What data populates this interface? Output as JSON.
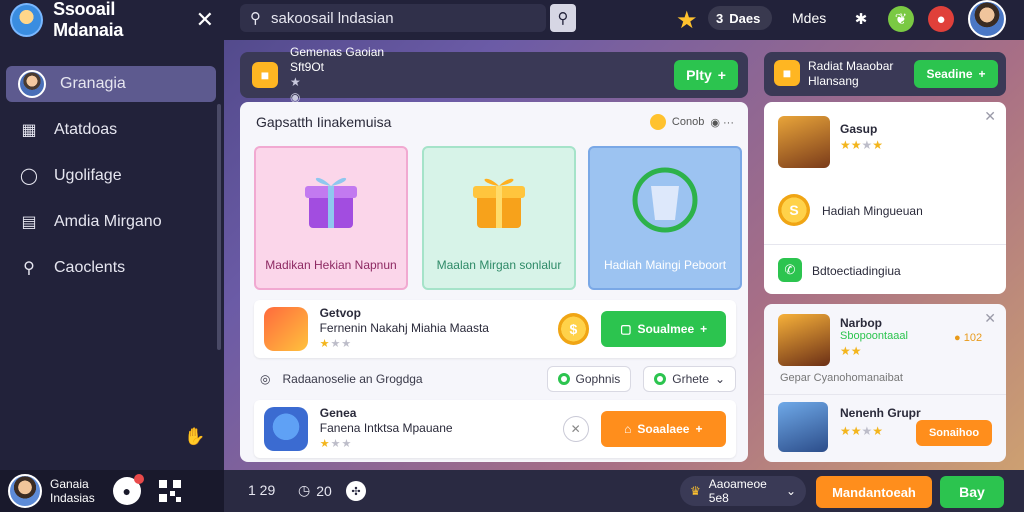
{
  "sidebar": {
    "app_title": "Ssooail Mdanaia",
    "items": [
      {
        "label": "Granagia",
        "icon": "avatar-icon",
        "active": true
      },
      {
        "label": "Atatdoas",
        "icon": "building-icon"
      },
      {
        "label": "Ugolifage",
        "icon": "pin-icon"
      },
      {
        "label": "Amdia Mirgano",
        "icon": "dashboard-icon"
      },
      {
        "label": "Caoclents",
        "icon": "people-icon"
      }
    ],
    "user": {
      "line1": "Ganaia",
      "line2": "Indasias"
    }
  },
  "topbar": {
    "search_value": "sakoosail lndasian",
    "coins_value": "3",
    "coins_label": "Daes",
    "label": "Mdes"
  },
  "main": {
    "header": {
      "title": "Gemenas Gaoian",
      "subtitle": "Sft9Ot"
    },
    "play_label": "Plty",
    "card_title": "Gapsatth Iinakemuisa",
    "card_meta": "Conob",
    "tiles": [
      {
        "label": "Madikan Hekian Napnun"
      },
      {
        "label": "Maalan Mirgan sonlalur"
      },
      {
        "label": "Hadiah Maingi Peboort"
      }
    ],
    "rows": [
      {
        "name": "Getvop",
        "desc": "Fernenin Nakahj Miahia Maasta",
        "stars": 1,
        "action": "Soualmee"
      },
      {
        "name": "Genea",
        "desc": "Fanena Intktsa Mpauane",
        "stars": 1,
        "action": "Soaalaee"
      }
    ],
    "filter": {
      "label": "Radaanoselie an Grogdga",
      "chip1": "Gophnis",
      "chip2": "Grhete"
    }
  },
  "right": {
    "header": {
      "title": "Radiat Maaobar",
      "subtitle": "Hlansang",
      "button": "Seadine"
    },
    "card1": {
      "name": "Gasup",
      "stars": 3,
      "coin_text": "Hadiah Mingueuan",
      "footer": "Bdtoectiadingiua"
    },
    "card2": {
      "name": "Narbop",
      "sub": "Sbopoontaaal",
      "value": "102",
      "desc": "Gepar Cyanohomanaibat",
      "name2": "Nenenh Grupr",
      "stars2": 3,
      "button": "Sonaihoo"
    }
  },
  "bottombar": {
    "count": "1 29",
    "timer": "20",
    "pill": "Aaoameoe 5e8",
    "btn1": "Mandantoeah",
    "btn2": "Bay"
  },
  "colors": {
    "accent_green": "#2cc44f",
    "accent_orange": "#ff8e1c",
    "sidebar_bg": "#22223a"
  }
}
